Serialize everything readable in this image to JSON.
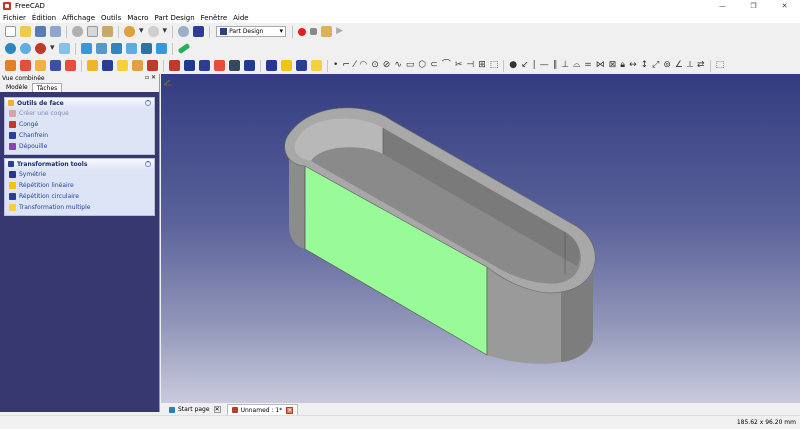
{
  "window": {
    "title": "FreeCAD",
    "controls": [
      "—",
      "❐",
      "✕"
    ]
  },
  "menu": [
    "Fichier",
    "Édition",
    "Affichage",
    "Outils",
    "Macro",
    "Part Design",
    "Fenêtre",
    "Aide"
  ],
  "workbench": {
    "selected": "Part Design"
  },
  "combo": {
    "title": "Vue combinée",
    "tabs": [
      "Modèle",
      "Tâches"
    ],
    "active_tab": "Tâches"
  },
  "panels": [
    {
      "title": "Outils de face",
      "items": [
        {
          "label": "Créer une coque",
          "disabled": true
        },
        {
          "label": "Congé"
        },
        {
          "label": "Chanfrein"
        },
        {
          "label": "Dépouille"
        }
      ]
    },
    {
      "title": "Transformation tools",
      "items": [
        {
          "label": "Symétrie"
        },
        {
          "label": "Répétition linéaire"
        },
        {
          "label": "Répétition circulaire"
        },
        {
          "label": "Transformation multiple"
        }
      ]
    }
  ],
  "doc_tabs": [
    {
      "label": "Start page",
      "active": false
    },
    {
      "label": "Unnamed : 1*",
      "active": true
    }
  ],
  "status": {
    "dimensions": "185.62 x 96.20 mm"
  },
  "colors": {
    "selected_face": "#98fb98",
    "model_gray": "#a0a0a0",
    "bg_top": "#333c80",
    "bg_bottom": "#c9cbdc"
  }
}
